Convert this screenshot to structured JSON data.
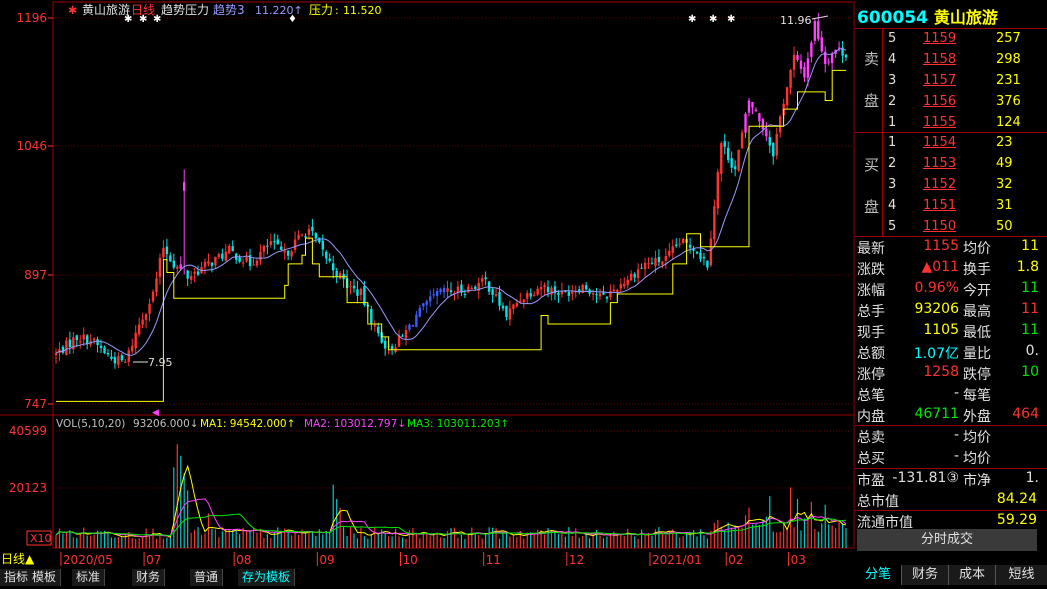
{
  "stock": {
    "code": "600054",
    "name": "黄山旅游",
    "period": "日线"
  },
  "price_panel": {
    "indicator_name": "趋势压力",
    "ind1_label": "趋势3",
    "ind1_value": "11.220↑",
    "ind2_label": "压力",
    "ind2_value": "11.520",
    "high_label": "11.96",
    "low_label": "7.95",
    "y_ticks": [
      "1196",
      "1046",
      "897",
      "747"
    ]
  },
  "vol_panel": {
    "label": "VOL(5,10,20)",
    "vol_value": "93206.000↓",
    "ma1": "MA1: 94542.000↑",
    "ma2": "MA2: 103012.797↓",
    "ma3": "MA3: 103011.203↑",
    "y_ticks": [
      "40599",
      "20123",
      "X10"
    ]
  },
  "x_axis": {
    "period_button": "日线▲",
    "labels": [
      "2020/05",
      "07",
      "08",
      "09",
      "10",
      "11",
      "12",
      "2021/01",
      "02",
      "03"
    ]
  },
  "bottom_tabs": [
    {
      "label": "指标",
      "active": false
    },
    {
      "label": "模板",
      "active": false
    },
    {
      "label": "标准",
      "active": false
    },
    {
      "label": "财务",
      "active": false
    },
    {
      "label": "普通",
      "active": false
    },
    {
      "label": "存为模板",
      "active": true
    }
  ],
  "orderbook": {
    "sell_label": [
      "卖",
      "盘"
    ],
    "buy_label": [
      "买",
      "盘"
    ],
    "asks": [
      {
        "level": "5",
        "price": "1159",
        "qty": "257"
      },
      {
        "level": "4",
        "price": "1158",
        "qty": "298"
      },
      {
        "level": "3",
        "price": "1157",
        "qty": "231"
      },
      {
        "level": "2",
        "price": "1156",
        "qty": "376"
      },
      {
        "level": "1",
        "price": "1155",
        "qty": "124"
      }
    ],
    "bids": [
      {
        "level": "1",
        "price": "1154",
        "qty": "23"
      },
      {
        "level": "2",
        "price": "1153",
        "qty": "49"
      },
      {
        "level": "3",
        "price": "1152",
        "qty": "32"
      },
      {
        "level": "4",
        "price": "1151",
        "qty": "31"
      },
      {
        "level": "5",
        "price": "1150",
        "qty": "50"
      }
    ]
  },
  "quote": [
    {
      "k1": "最新",
      "v1": "1155",
      "c1": "red",
      "k2": "均价",
      "v2": "11",
      "c2": "yel"
    },
    {
      "k1": "涨跌",
      "v1": "▲011",
      "c1": "red",
      "k2": "换手",
      "v2": "1.8",
      "c2": "yel"
    },
    {
      "k1": "涨幅",
      "v1": "0.96%",
      "c1": "red",
      "k2": "今开",
      "v2": "11",
      "c2": "grn"
    },
    {
      "k1": "总手",
      "v1": "93206",
      "c1": "yel",
      "k2": "最高",
      "v2": "11",
      "c2": "red"
    },
    {
      "k1": "现手",
      "v1": "1105",
      "c1": "yel",
      "k2": "最低",
      "v2": "11",
      "c2": "grn"
    },
    {
      "k1": "总额",
      "v1": "1.07亿",
      "c1": "cyn",
      "k2": "量比",
      "v2": "0.",
      "c2": "wht"
    },
    {
      "k1": "涨停",
      "v1": "1258",
      "c1": "red",
      "k2": "跌停",
      "v2": "10",
      "c2": "grn"
    },
    {
      "k1": "总笔",
      "v1": "-",
      "c1": "wht",
      "k2": "每笔",
      "v2": "",
      "c2": "wht"
    },
    {
      "k1": "内盘",
      "v1": "46711",
      "c1": "grn",
      "k2": "外盘",
      "v2": "464",
      "c2": "red"
    },
    {
      "k1": "总卖",
      "v1": "-",
      "c1": "wht",
      "k2": "均价",
      "v2": "",
      "c2": "wht"
    },
    {
      "k1": "总买",
      "v1": "-",
      "c1": "wht",
      "k2": "均价",
      "v2": "",
      "c2": "wht"
    },
    {
      "k1": "市盈",
      "v1": "-131.81③",
      "c1": "wht",
      "k2": "市净",
      "v2": "1.",
      "c2": "wht"
    },
    {
      "k1": "总市值",
      "v1": "84.24",
      "c1": "yel",
      "k2": "",
      "v2": "",
      "c2": "wht"
    },
    {
      "k1": "流通市值",
      "v1": "59.29",
      "c1": "yel",
      "k2": "",
      "v2": "",
      "c2": "wht"
    }
  ],
  "tick_button": "分时成交",
  "right_tabs": [
    {
      "label": "分笔",
      "active": true
    },
    {
      "label": "财务",
      "active": false
    },
    {
      "label": "成本",
      "active": false
    },
    {
      "label": "短线",
      "active": false
    }
  ],
  "colors": {
    "up": "#ff3232",
    "down": "#00e6e6",
    "magenta": "#ff40ff",
    "blue": "#3a5cff",
    "yellow": "#ffff00",
    "ma_violet": "#9a9aff",
    "grid": "#8b0000"
  },
  "chart_data": {
    "type": "candlestick",
    "x_labels": [
      "2020/05",
      "07",
      "08",
      "09",
      "10",
      "11",
      "12",
      "2021/01",
      "02",
      "03"
    ],
    "ylim": [
      7.47,
      11.96
    ],
    "price_ticks": [
      11.96,
      10.46,
      8.97,
      7.47
    ],
    "anchors": [
      [
        0,
        8.05
      ],
      [
        6,
        8.25
      ],
      [
        10,
        8.22
      ],
      [
        16,
        8.0
      ],
      [
        20,
        7.95
      ],
      [
        24,
        8.4
      ],
      [
        28,
        8.75
      ],
      [
        31,
        9.3
      ],
      [
        34,
        9.1
      ],
      [
        38,
        8.95
      ],
      [
        44,
        9.1
      ],
      [
        50,
        9.25
      ],
      [
        56,
        9.1
      ],
      [
        62,
        9.35
      ],
      [
        66,
        9.2
      ],
      [
        70,
        9.4
      ],
      [
        73,
        9.5
      ],
      [
        76,
        9.3
      ],
      [
        80,
        9.05
      ],
      [
        84,
        8.85
      ],
      [
        88,
        8.75
      ],
      [
        92,
        8.35
      ],
      [
        96,
        8.1
      ],
      [
        100,
        8.25
      ],
      [
        104,
        8.5
      ],
      [
        110,
        8.75
      ],
      [
        118,
        8.8
      ],
      [
        124,
        8.9
      ],
      [
        130,
        8.5
      ],
      [
        134,
        8.7
      ],
      [
        140,
        8.85
      ],
      [
        146,
        8.75
      ],
      [
        152,
        8.85
      ],
      [
        158,
        8.7
      ],
      [
        164,
        8.9
      ],
      [
        170,
        9.1
      ],
      [
        176,
        9.15
      ],
      [
        180,
        9.35
      ],
      [
        184,
        9.3
      ],
      [
        188,
        9.1
      ],
      [
        192,
        10.5
      ],
      [
        196,
        10.2
      ],
      [
        200,
        11.0
      ],
      [
        204,
        10.7
      ],
      [
        207,
        10.4
      ],
      [
        210,
        11.0
      ],
      [
        213,
        11.5
      ],
      [
        216,
        11.3
      ],
      [
        219,
        11.9
      ],
      [
        222,
        11.45
      ],
      [
        225,
        11.6
      ],
      [
        228,
        11.55
      ]
    ],
    "pressure_steps": [
      [
        0,
        7.5
      ],
      [
        31,
        9.15
      ],
      [
        32,
        9.0
      ],
      [
        34,
        8.7
      ],
      [
        40,
        8.7
      ],
      [
        66,
        8.85
      ],
      [
        67,
        9.1
      ],
      [
        71,
        9.2
      ],
      [
        72,
        9.4
      ],
      [
        74,
        9.1
      ],
      [
        76,
        8.95
      ],
      [
        84,
        8.65
      ],
      [
        90,
        8.4
      ],
      [
        94,
        8.25
      ],
      [
        96,
        8.1
      ],
      [
        140,
        8.5
      ],
      [
        142,
        8.4
      ],
      [
        150,
        8.4
      ],
      [
        160,
        8.65
      ],
      [
        162,
        8.75
      ],
      [
        176,
        8.75
      ],
      [
        178,
        9.1
      ],
      [
        182,
        9.45
      ],
      [
        186,
        9.3
      ],
      [
        190,
        9.3
      ],
      [
        200,
        10.7
      ],
      [
        210,
        10.9
      ],
      [
        214,
        11.1
      ],
      [
        222,
        11.0
      ],
      [
        224,
        11.35
      ]
    ],
    "volume": {
      "vlim": [
        0,
        40599
      ],
      "ticks": [
        40599,
        20123
      ],
      "base_level": 5200,
      "spikes": [
        [
          34,
          28000,
          40599
        ],
        [
          35,
          36000,
          20000
        ],
        [
          36,
          32000,
          18000
        ],
        [
          37,
          26000,
          14000
        ],
        [
          38,
          20000
        ],
        [
          44,
          12000
        ],
        [
          80,
          22000
        ],
        [
          81,
          17000
        ],
        [
          82,
          14000
        ],
        [
          200,
          14000
        ],
        [
          206,
          18000
        ],
        [
          212,
          21000
        ],
        [
          214,
          17000
        ],
        [
          218,
          16000
        ],
        [
          222,
          15000
        ]
      ]
    },
    "series": [
      {
        "name": "MA1"
      },
      {
        "name": "MA2"
      },
      {
        "name": "MA3"
      }
    ]
  }
}
